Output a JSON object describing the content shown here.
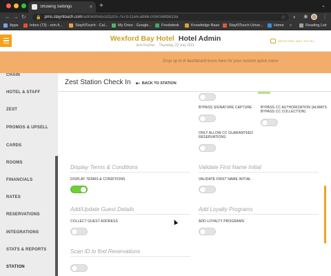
{
  "browser": {
    "tab_title": "Showing Settings",
    "tab_close": "×",
    "new_tab": "+",
    "tab_dropdown": "⌄",
    "url_host": "pms.stayntouch.com",
    "url_path": "/admin/h/e51d32c5-757d-11e6-a868-0050568b819a",
    "bookmarks": [
      {
        "label": "Apps",
        "color": "#7aa3e6"
      },
      {
        "label": "Inbox (73) - erin.fi...",
        "color": "#e34f3f"
      },
      {
        "label": "StayNTouch - Cal...",
        "color": "#e8a33a"
      },
      {
        "label": "My Drive - Google...",
        "color": "#4fb36a"
      },
      {
        "label": "Freshdesk",
        "color": "#3fa568"
      },
      {
        "label": "Knowledge Base",
        "color": "#d9a23a"
      },
      {
        "label": "StayNTouch Unive...",
        "color": "#e05a3a"
      },
      {
        "label": "Home",
        "color": "#3b8fd9"
      }
    ],
    "bookmarks_more": "»",
    "reading_list": "Reading List"
  },
  "header": {
    "hotel_name": "Wexford Bay Hotel",
    "admin_label": "Hotel Admin",
    "user_name": "Erin Fischer",
    "date": "Thursday, 22 July 2021",
    "logo_text": "WEXFORD BAY HOTEL"
  },
  "banner": {
    "hint": "Drop up to 8 dashboard icons here for your custom quick menu"
  },
  "sidebar": {
    "items": [
      {
        "label": "CHAIN"
      },
      {
        "label": "HOTEL & STAFF"
      },
      {
        "label": "ZEST"
      },
      {
        "label": "PROMOS & UPSELL"
      },
      {
        "label": "CARDS"
      },
      {
        "label": "ROOMS"
      },
      {
        "label": "FINANCIALS"
      },
      {
        "label": "RATES"
      },
      {
        "label": "RESERVATIONS"
      },
      {
        "label": "INTEGRATIONS"
      },
      {
        "label": "STATS & REPORTS"
      },
      {
        "label": "STATION",
        "active": true
      }
    ]
  },
  "main": {
    "page_title": "Zest Station Check In",
    "back_label": "BACK TO STATION",
    "settings": {
      "bypass_signature": {
        "label": "BYPASS SIGNATURE CAPTURE",
        "on": false
      },
      "bypass_cc_auth": {
        "label": "BYPASS CC AUTHORIZATION (ALWAYS BYPASS CC COLLECTION)",
        "on": false
      },
      "only_allow_cc": {
        "label": "ONLY ALLOW CC GUARANTEED RESERVATIONS",
        "on": false
      },
      "display_terms": {
        "section": "Display Terms & Conditions",
        "label": "DISPLAY TERMS & CONDITIONS",
        "on": true
      },
      "validate_first_name": {
        "section": "Validate First Name Initial",
        "label": "VALIDATE FIRST NAME INITIAL",
        "on": false
      },
      "guest_details": {
        "section": "Add/Update Guest Details",
        "label": "COLLECT GUEST ADDRESS",
        "on": false
      },
      "loyalty": {
        "section": "Add Loyalty Programs",
        "label": "ADD LOYALTY PROGRAMS",
        "on": false
      },
      "scan_id": {
        "section": "Scan ID to find Reservations",
        "on": false
      }
    }
  },
  "colors": {
    "accent_orange": "#f6a01a",
    "banner": "#f3ad6a",
    "gold": "#c9a227",
    "toggle_on": "#6fcf3a"
  }
}
